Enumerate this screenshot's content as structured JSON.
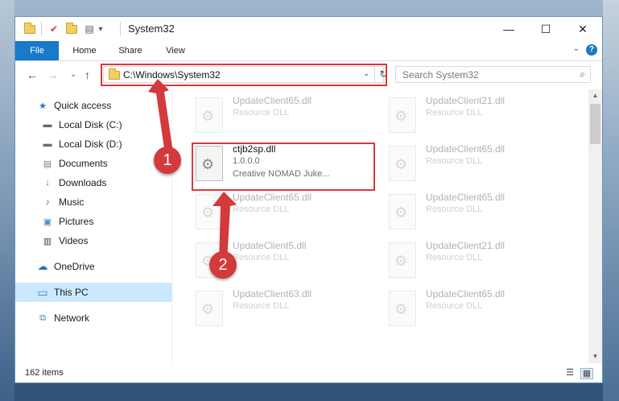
{
  "window": {
    "title": "System32",
    "minimize_glyph": "—",
    "maximize_glyph": "☐",
    "close_glyph": "✕"
  },
  "quick_access_toolbar": {
    "properties_glyph": "✔",
    "dropdown_glyph": "▾"
  },
  "ribbon": {
    "tabs": [
      "File",
      "Home",
      "Share",
      "View"
    ],
    "help_label": "?",
    "collapse_glyph": "⌄"
  },
  "navigation": {
    "back_glyph": "←",
    "forward_glyph": "→",
    "recent_glyph": "⌄",
    "up_glyph": "↑",
    "address": "C:\\Windows\\System32",
    "address_dropdown_glyph": "⌄",
    "refresh_glyph": "↻",
    "search_placeholder": "Search System32",
    "search_glyph": "⌕"
  },
  "sidebar": {
    "items": [
      {
        "label": "Quick access",
        "icon": "star-icon",
        "glyph": "★",
        "color": "#1e74c5",
        "pinned": false
      },
      {
        "label": "Local Disk (C:)",
        "icon": "drive-icon",
        "glyph": "▬",
        "color": "#5b6a78",
        "pinned": false
      },
      {
        "label": "Local Disk (D:)",
        "icon": "drive-icon",
        "glyph": "▬",
        "color": "#5b6a78",
        "pinned": false
      },
      {
        "label": "Documents",
        "icon": "document-icon",
        "glyph": "▤",
        "color": "#6f7f8f",
        "pinned": false
      },
      {
        "label": "Downloads",
        "icon": "download-icon",
        "glyph": "↓",
        "color": "#1e74c5",
        "pinned": true
      },
      {
        "label": "Music",
        "icon": "music-icon",
        "glyph": "♪",
        "color": "#1e74c5",
        "pinned": true
      },
      {
        "label": "Pictures",
        "icon": "picture-icon",
        "glyph": "▣",
        "color": "#4a8bc9",
        "pinned": true
      },
      {
        "label": "Videos",
        "icon": "video-icon",
        "glyph": "▥",
        "color": "#444",
        "pinned": true
      },
      {
        "label": "OneDrive",
        "icon": "cloud-icon",
        "glyph": "☁",
        "color": "#1e74c5",
        "pinned": false
      },
      {
        "label": "This PC",
        "icon": "computer-icon",
        "glyph": "▭",
        "color": "#3a87c9",
        "pinned": false,
        "selected": true
      },
      {
        "label": "Network",
        "icon": "network-icon",
        "glyph": "⧉",
        "color": "#3a87c9",
        "pinned": false
      }
    ],
    "pin_glyph": "📌"
  },
  "files": [
    {
      "name": "UpdateClient65.dll",
      "type": "Resource DLL"
    },
    {
      "name": "UpdateClient21.dll",
      "type": "Resource DLL"
    },
    {
      "name": "ctjb2sp.dll",
      "version": "1.0.0.0",
      "description": "Creative NOMAD Juke...",
      "highlighted": true
    },
    {
      "name": "UpdateClient65.dll",
      "type": "Resource DLL"
    },
    {
      "name": "UpdateClient65.dll",
      "type": "Resource DLL"
    },
    {
      "name": "UpdateClient65.dll",
      "type": "Resource DLL"
    },
    {
      "name": "UpdateClient5.dll",
      "type": "Resource DLL"
    },
    {
      "name": "UpdateClient21.dll",
      "type": "Resource DLL"
    },
    {
      "name": "UpdateClient63.dll",
      "type": "Resource DLL"
    },
    {
      "name": "UpdateClient65.dll",
      "type": "Resource DLL"
    }
  ],
  "status": {
    "item_count": "162 items",
    "details_view_glyph": "☰",
    "tiles_view_glyph": "▦"
  },
  "callouts": [
    "1",
    "2"
  ],
  "colors": {
    "accent": "#1979ca",
    "callout_red": "#d33a3c",
    "selection": "#cce8ff"
  }
}
